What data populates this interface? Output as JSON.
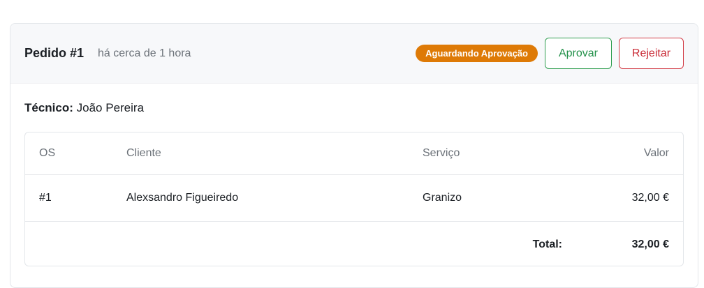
{
  "order": {
    "title": "Pedido #1",
    "time": "há cerca de 1 hora",
    "status": "Aguardando Aprovação",
    "approve_label": "Aprovar",
    "reject_label": "Rejeitar"
  },
  "technician": {
    "label": "Técnico:",
    "name": "João Pereira"
  },
  "table": {
    "headers": [
      "OS",
      "Cliente",
      "Serviço",
      "Valor"
    ],
    "rows": [
      {
        "os": "#1",
        "client": "Alexsandro Figueiredo",
        "service": "Granizo",
        "value": "32,00 €"
      }
    ],
    "total_label": "Total:",
    "total_value": "32,00 €"
  },
  "colors": {
    "status_badge": "#de7a06",
    "approve": "#23914a",
    "reject": "#c92a35"
  }
}
